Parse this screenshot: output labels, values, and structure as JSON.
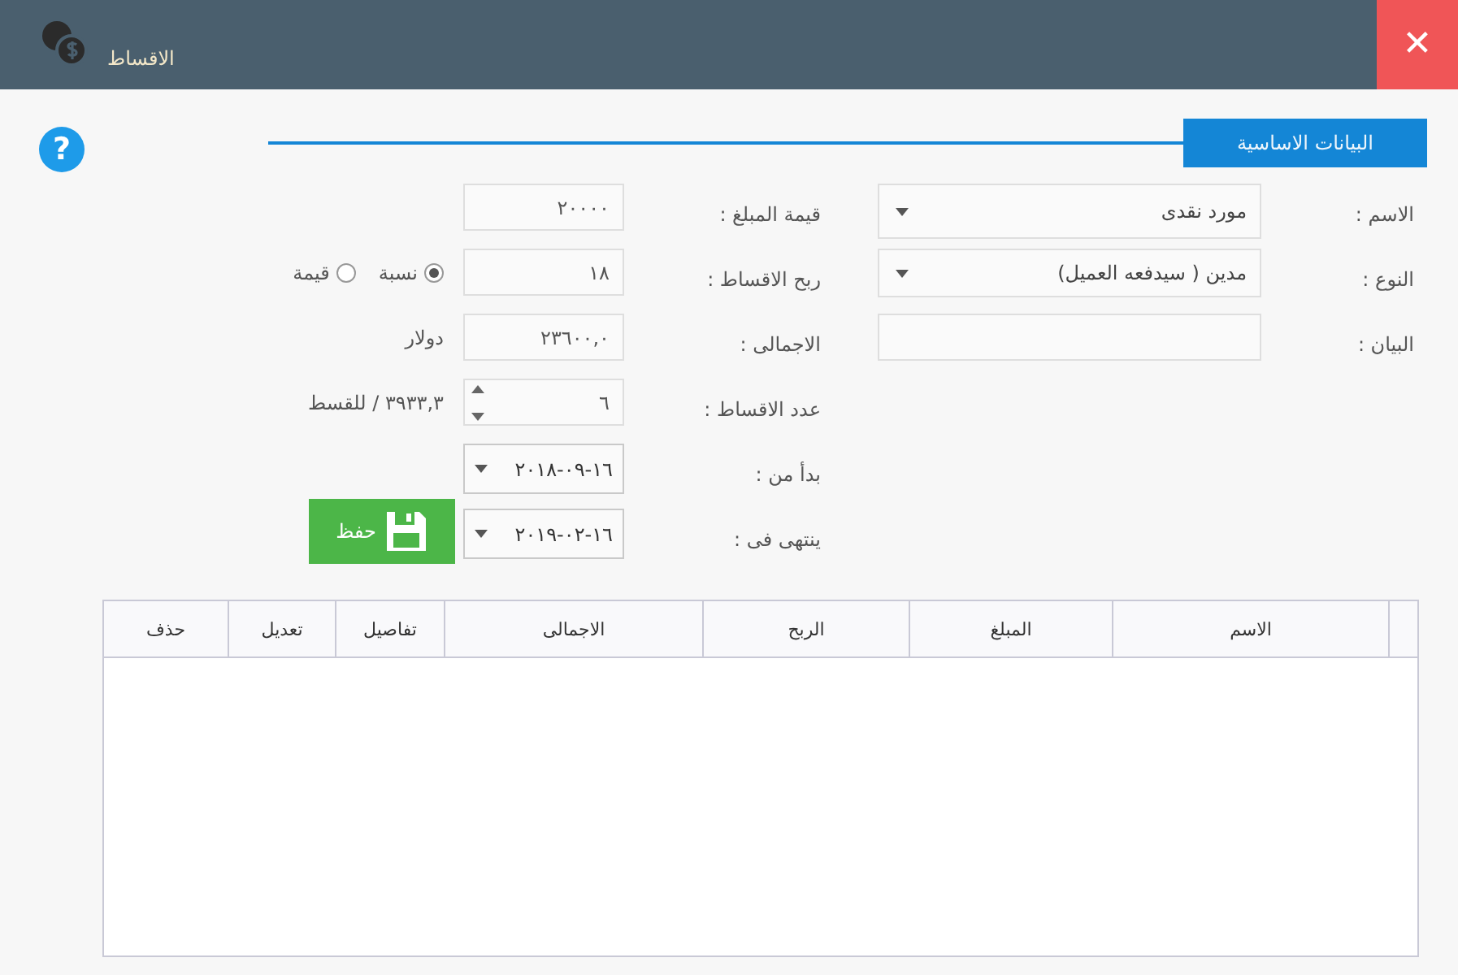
{
  "window": {
    "title": "الاقساط",
    "close": "✕"
  },
  "section_tab": {
    "label": "البيانات الاساسية"
  },
  "help": "?",
  "form": {
    "name": {
      "label": "الاسم :",
      "value": "مورد نقدى"
    },
    "type": {
      "label": "النوع :",
      "value": "مدين ( سيدفعه العميل)"
    },
    "statement": {
      "label": "البيان :"
    },
    "amount": {
      "label": "قيمة المبلغ :",
      "value": "٢٠٠٠٠"
    },
    "profit": {
      "label": "ربح الاقساط :",
      "value": "١٨"
    },
    "profit_modes": [
      {
        "label": "نسبة",
        "selected": true
      },
      {
        "label": "قيمة",
        "selected": false
      }
    ],
    "total": {
      "label": "الاجمالى :",
      "value": "٢٣٦٠٠,٠",
      "unit": "دولار"
    },
    "count": {
      "label": "عدد الاقساط :",
      "value": "٦",
      "per_installment": "٣٩٣٣,٣ / للقسط"
    },
    "start": {
      "label": "بدأ من :",
      "value": "١٦-٠٩-٢٠١٨"
    },
    "end": {
      "label": "ينتهى فى :",
      "value": "١٦-٠٢-٢٠١٩"
    },
    "save": "حفظ"
  },
  "table": {
    "columns": [
      "الاسم",
      "المبلغ",
      "الربح",
      "الاجمالى",
      "تفاصيل",
      "تعديل",
      "حذف"
    ]
  }
}
